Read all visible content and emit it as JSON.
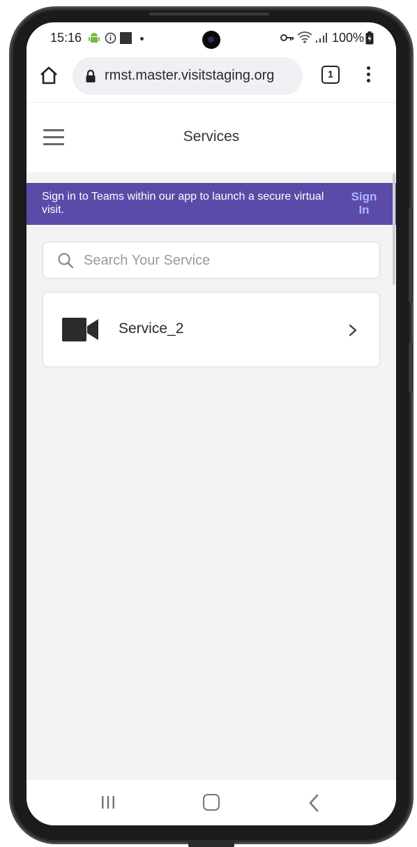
{
  "status_bar": {
    "time": "15:16",
    "battery": "100%",
    "icons": [
      "android-icon",
      "info-icon",
      "square-notification-icon",
      "dot-icon",
      "key-icon",
      "wifi-icon",
      "signal-icon",
      "battery-icon"
    ]
  },
  "browser": {
    "url": "rmst.master.visitstaging.org",
    "tab_count": "1"
  },
  "header": {
    "title": "Services"
  },
  "banner": {
    "message": "Sign in to Teams within our app to launch a secure virtual visit.",
    "link_label": "Sign In",
    "background_color": "#5b4aa8",
    "link_color": "#a9b8ff"
  },
  "search": {
    "placeholder": "Search Your Service",
    "value": ""
  },
  "services": [
    {
      "name": "Service_2",
      "icon": "video-camera-icon"
    }
  ]
}
